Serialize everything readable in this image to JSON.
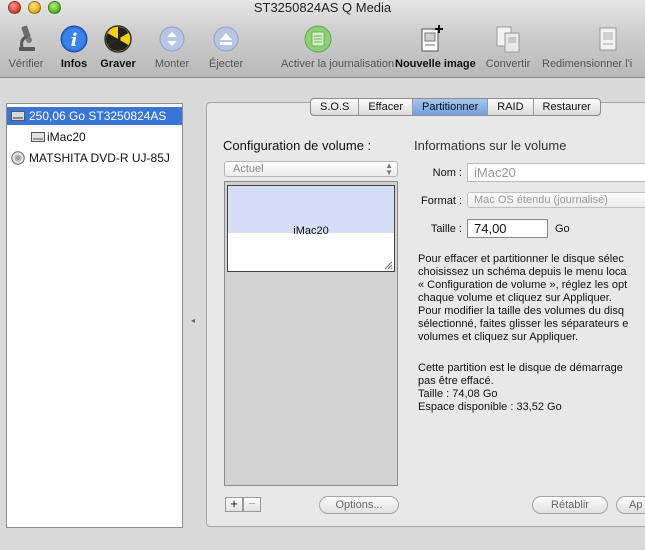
{
  "window": {
    "title": "ST3250824AS Q Media"
  },
  "toolbar": {
    "items": [
      {
        "label": "Vérifier",
        "enabled": false
      },
      {
        "label": "Infos",
        "enabled": true
      },
      {
        "label": "Graver",
        "enabled": true
      },
      {
        "label": "Monter",
        "enabled": false
      },
      {
        "label": "Éjecter",
        "enabled": false
      },
      {
        "label": "Activer la journalisation",
        "enabled": false
      },
      {
        "label": "Nouvelle image",
        "enabled": true
      },
      {
        "label": "Convertir",
        "enabled": false
      },
      {
        "label": "Redimensionner l'i",
        "enabled": false
      }
    ]
  },
  "sidebar": {
    "items": [
      {
        "label": "250,06 Go ST3250824AS",
        "selected": true
      },
      {
        "label": "iMac20",
        "selected": false
      },
      {
        "label": "MATSHITA DVD-R UJ-85J",
        "selected": false
      }
    ]
  },
  "tabs": [
    {
      "label": "S.O.S",
      "active": false
    },
    {
      "label": "Effacer",
      "active": false
    },
    {
      "label": "Partitionner",
      "active": true
    },
    {
      "label": "RAID",
      "active": false
    },
    {
      "label": "Restaurer",
      "active": false
    }
  ],
  "volume_config": {
    "title": "Configuration de volume :",
    "scheme_value": "Actuel",
    "partition_name": "iMac20",
    "add_label": "+",
    "remove_label": "−",
    "options_label": "Options..."
  },
  "volume_info": {
    "title": "Informations sur le volume",
    "name_label": "Nom :",
    "name_value": "iMac20",
    "format_label": "Format :",
    "format_value": "Mac OS étendu (journalisé)",
    "size_label": "Taille :",
    "size_value": "74,00",
    "size_unit": "Go",
    "help_text": "Pour effacer et partitionner le disque sélec\nchoisissez un schéma depuis le menu loca\n« Configuration de volume », réglez les opt\nchaque volume et cliquez sur Appliquer.\nPour modifier la taille des volumes du disq\nsélectionné, faites glisser les séparateurs e\nvolumes et cliquez sur Appliquer.",
    "status_text": "Cette partition est le disque de démarrage\npas être effacé.\nTaille : 74,08 Go\nEspace disponible : 33,52 Go"
  },
  "buttons": {
    "revert_label": "Rétablir",
    "apply_label": "Ap"
  },
  "colors": {
    "selection": "#3875d7",
    "tab_active": "#8bb2e8",
    "partition_fill": "#d4dcf6"
  }
}
